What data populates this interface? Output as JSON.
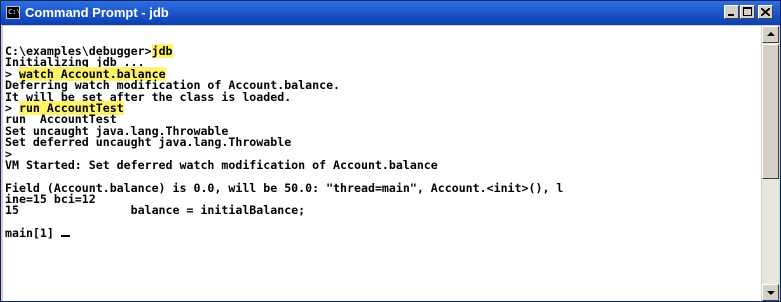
{
  "window": {
    "title": "Command Prompt - jdb",
    "icon": "console-icon",
    "icon_glyph": "C:\\"
  },
  "title_buttons": {
    "minimize": "minimize-icon",
    "maximize": "maximize-icon",
    "close": "close-icon"
  },
  "console": {
    "lines": [
      {
        "pre": "C:\\examples\\debugger>",
        "hl": "jdb",
        "post": ""
      },
      {
        "pre": "Initializing jdb ...",
        "hl": "",
        "post": ""
      },
      {
        "pre": "> ",
        "hl": "watch Account.balance",
        "post": ""
      },
      {
        "pre": "Deferring watch modification of Account.balance.",
        "hl": "",
        "post": ""
      },
      {
        "pre": "It will be set after the class is loaded.",
        "hl": "",
        "post": ""
      },
      {
        "pre": "> ",
        "hl": "run AccountTest",
        "post": ""
      },
      {
        "pre": "run  AccountTest",
        "hl": "",
        "post": ""
      },
      {
        "pre": "Set uncaught java.lang.Throwable",
        "hl": "",
        "post": ""
      },
      {
        "pre": "Set deferred uncaught java.lang.Throwable",
        "hl": "",
        "post": ""
      },
      {
        "pre": ">",
        "hl": "",
        "post": ""
      },
      {
        "pre": "VM Started: Set deferred watch modification of Account.balance",
        "hl": "",
        "post": ""
      },
      {
        "pre": "",
        "hl": "",
        "post": ""
      },
      {
        "pre": "Field (Account.balance) is 0.0, will be 50.0: \"thread=main\", Account.<init>(), l",
        "hl": "",
        "post": ""
      },
      {
        "pre": "ine=15 bci=12",
        "hl": "",
        "post": ""
      },
      {
        "pre": "15                balance = initialBalance;",
        "hl": "",
        "post": ""
      },
      {
        "pre": "",
        "hl": "",
        "post": ""
      },
      {
        "pre": "main[1] ",
        "hl": "",
        "post": ""
      }
    ]
  },
  "colors": {
    "titlebar": "#1c55c9",
    "highlight": "#fff36a",
    "console_bg": "#ffffff",
    "console_text": "#000000"
  }
}
